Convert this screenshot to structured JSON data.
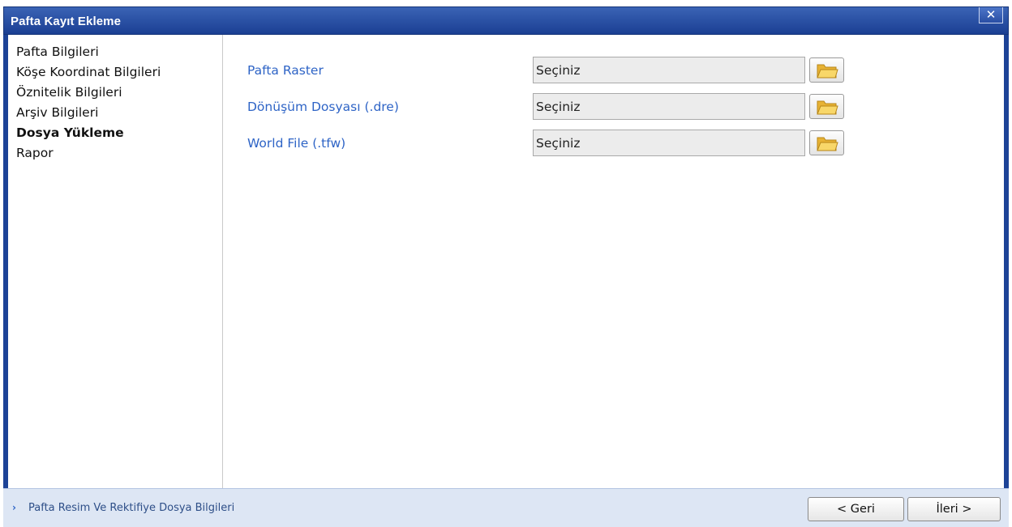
{
  "dialog": {
    "title": "Pafta Kayıt Ekleme",
    "close_glyph": "✕"
  },
  "sidebar": {
    "items": [
      {
        "label": "Pafta Bilgileri",
        "active": false
      },
      {
        "label": "Köşe Koordinat Bilgileri",
        "active": false
      },
      {
        "label": "Öznitelik Bilgileri",
        "active": false
      },
      {
        "label": "Arşiv Bilgileri",
        "active": false
      },
      {
        "label": "Dosya Yükleme",
        "active": true
      },
      {
        "label": "Rapor",
        "active": false
      }
    ]
  },
  "form": {
    "rows": [
      {
        "label": "Pafta Raster",
        "value": "Seçiniz",
        "button_icon": "folder-open-icon"
      },
      {
        "label": "Dönüşüm Dosyası (.dre)",
        "value": "Seçiniz",
        "button_icon": "folder-open-icon"
      },
      {
        "label": "World File (.tfw)",
        "value": "Seçiniz",
        "button_icon": "folder-open-icon"
      }
    ]
  },
  "footer": {
    "status_arrow": "›",
    "status_text": "Pafta Resim Ve Rektifiye Dosya Bilgileri",
    "back_label": "< Geri",
    "next_label": "İleri >"
  },
  "colors": {
    "title_bar": "#1b3f93",
    "label_blue": "#2e64c6",
    "footer_bg": "#dde6f4",
    "folder_yellow": "#f3c746"
  }
}
